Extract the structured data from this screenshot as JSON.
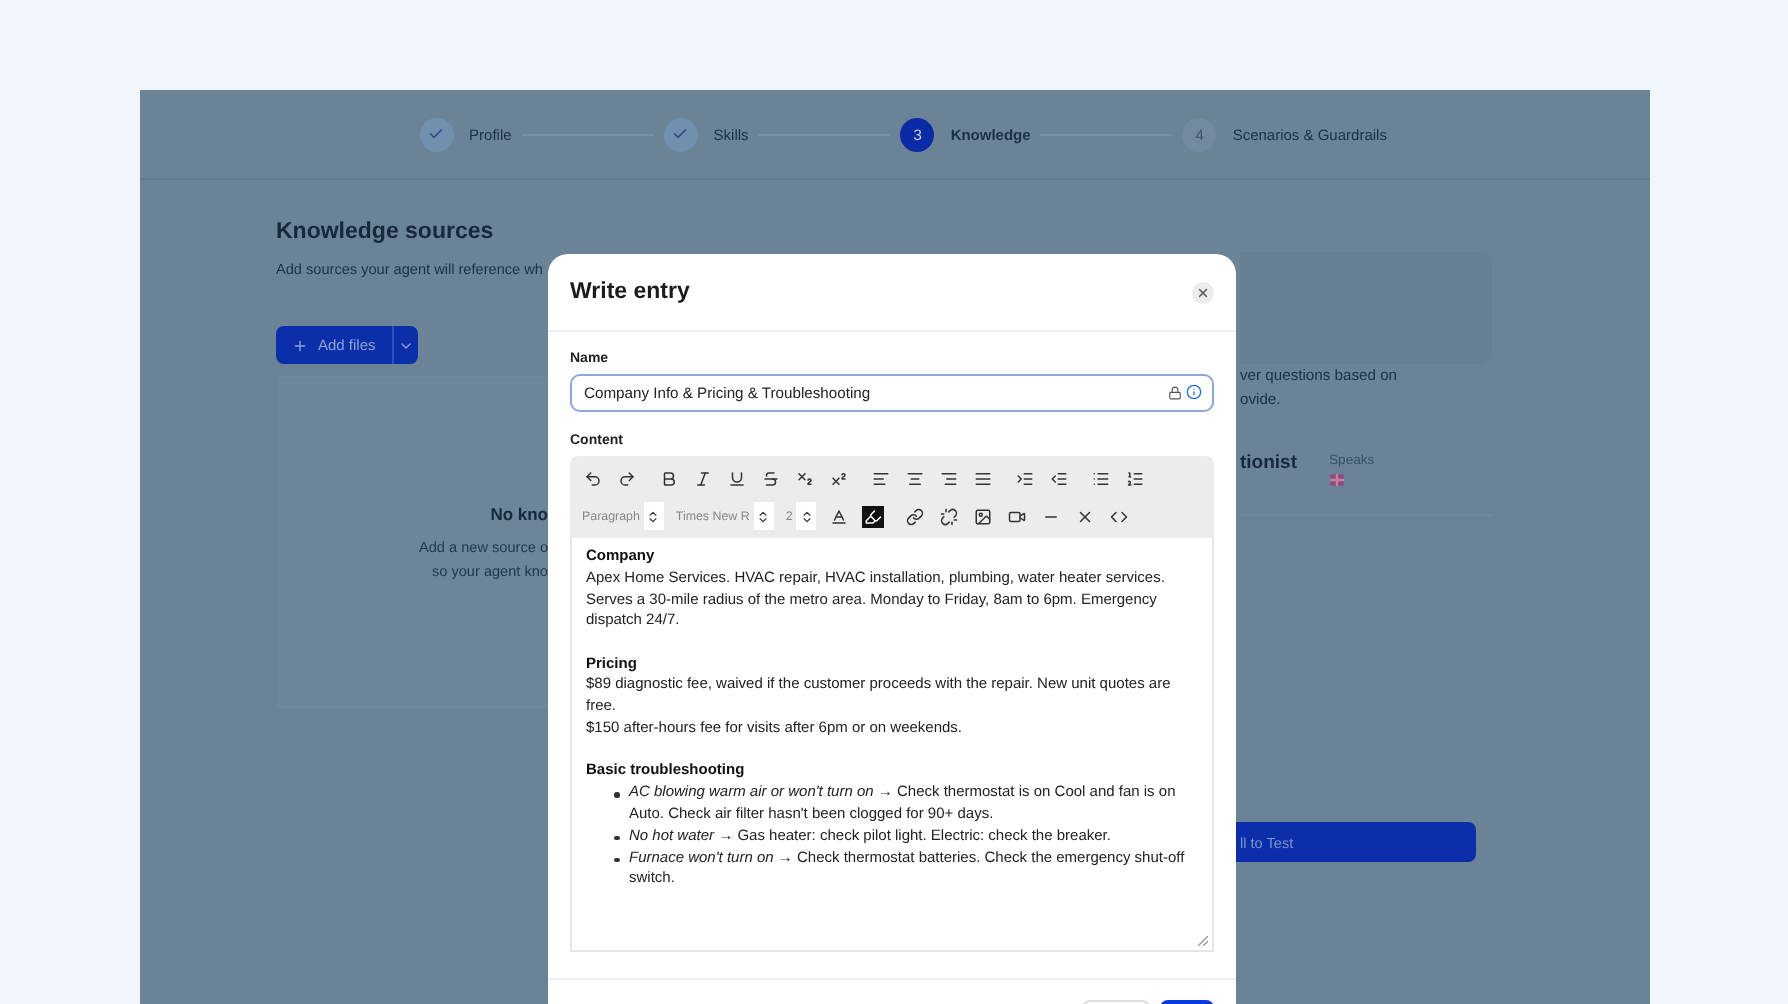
{
  "stepper": [
    {
      "label": "Profile",
      "done": true,
      "selected": false
    },
    {
      "label": "Skills",
      "done": true,
      "selected": false
    },
    {
      "label": "Knowledge",
      "number": "3",
      "done": false,
      "selected": true
    },
    {
      "label": "Scenarios & Guardrails",
      "number": "4",
      "done": false,
      "selected": false
    }
  ],
  "page": {
    "title": "Knowledge sources",
    "subtitle": "Add sources your agent will reference wh",
    "add_button": "Add files",
    "empty_state": {
      "title": "No kno",
      "lines": [
        "Add a new source o",
        "so your agent kno"
      ]
    },
    "right_panel": {
      "description_lines": [
        "ver questions based on",
        "ovide."
      ],
      "agent_name": "tionist",
      "speaks_label": "Speaks"
    },
    "test_button": "ll to Test"
  },
  "modal": {
    "title": "Write entry",
    "name_label": "Name",
    "name_value": "Company Info & Pricing & Troubleshooting",
    "content_label": "Content",
    "toolbar": {
      "paragraph": "Paragraph",
      "font": "Times New R",
      "size": "2"
    },
    "sections": [
      {
        "heading": "Company",
        "paragraphs": [
          "Apex Home Services. HVAC repair, HVAC installation, plumbing, water heater services. Serves a 30-mile radius of the metro area. Monday to Friday, 8am to 6pm. Emergency dispatch 24/7."
        ]
      },
      {
        "heading": "Pricing",
        "paragraphs": [
          "$89 diagnostic fee, waived if the customer proceeds with the repair. New unit quotes are free.",
          "$150 after-hours fee for visits after 6pm or on weekends."
        ]
      },
      {
        "heading": "Basic troubleshooting",
        "bullets": [
          "*AC blowing warm air or won't turn on* → Check thermostat is on Cool and fan is on Auto. Check air filter hasn't been clogged for 90+ days.",
          "*No hot water* → Gas heater: check pilot light. Electric: check the breaker.",
          "*Furnace won't turn on* → Check thermostat batteries. Check the emergency shut-off switch."
        ]
      }
    ]
  }
}
